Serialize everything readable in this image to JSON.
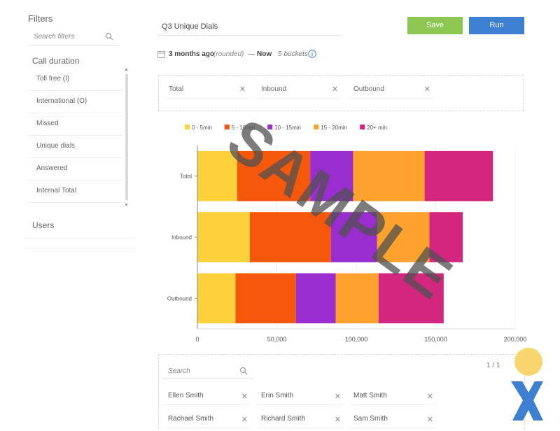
{
  "sidebar": {
    "filters_title": "Filters",
    "search_placeholder": "Search filters",
    "section_call_duration": "Call duration",
    "items": [
      {
        "label": "Toll free (I)"
      },
      {
        "label": "International (O)"
      },
      {
        "label": "Missed"
      },
      {
        "label": "Unique dials"
      },
      {
        "label": "Answered"
      },
      {
        "label": "Internal Total"
      }
    ],
    "section_users": "Users"
  },
  "header": {
    "report_title": "Q3 Unique Dials",
    "save_label": "Save",
    "run_label": "Run",
    "save_color": "#8cc751",
    "run_color": "#3d7fd0"
  },
  "timerange": {
    "from": "3 months ago",
    "from_note": "(rounded)",
    "dash": "—",
    "to": "Now",
    "buckets": "5 buckets",
    "icons": [
      "calendar-icon",
      "info-icon"
    ]
  },
  "series_tags": [
    {
      "label": "Total"
    },
    {
      "label": "Inbound"
    },
    {
      "label": "Outbound"
    }
  ],
  "chart_data": {
    "type": "bar",
    "orientation": "horizontal",
    "stacked": true,
    "categories": [
      "Total",
      "Inbound",
      "Outbound"
    ],
    "series": [
      {
        "name": "0 - 5min",
        "color": "#fdd13a",
        "values": [
          25000,
          33000,
          24000
        ]
      },
      {
        "name": "5 - 10min",
        "color": "#f6580b",
        "values": [
          46000,
          51000,
          38000
        ]
      },
      {
        "name": "10 - 15min",
        "color": "#9a2dd0",
        "values": [
          27000,
          29000,
          25000
        ]
      },
      {
        "name": "15 - 20min",
        "color": "#fda22c",
        "values": [
          45000,
          33000,
          27000
        ]
      },
      {
        "name": "20+ min",
        "color": "#d3267e",
        "values": [
          43000,
          21000,
          41000
        ]
      }
    ],
    "xlim": [
      0,
      200000
    ],
    "xticks": [
      "0",
      "50,000",
      "100,000",
      "150,000",
      "200,000"
    ],
    "legend": "top-left",
    "grid": true
  },
  "people_search_placeholder": "Search",
  "pager": "1 / 1",
  "people": [
    {
      "name": "Ellen Smith"
    },
    {
      "name": "Erin Smith"
    },
    {
      "name": "Matt Smith"
    },
    {
      "name": "Rachael Smith"
    },
    {
      "name": "Richard Smith"
    },
    {
      "name": "Sam Smith"
    }
  ],
  "watermark": "SAMPLE",
  "logo": "X"
}
